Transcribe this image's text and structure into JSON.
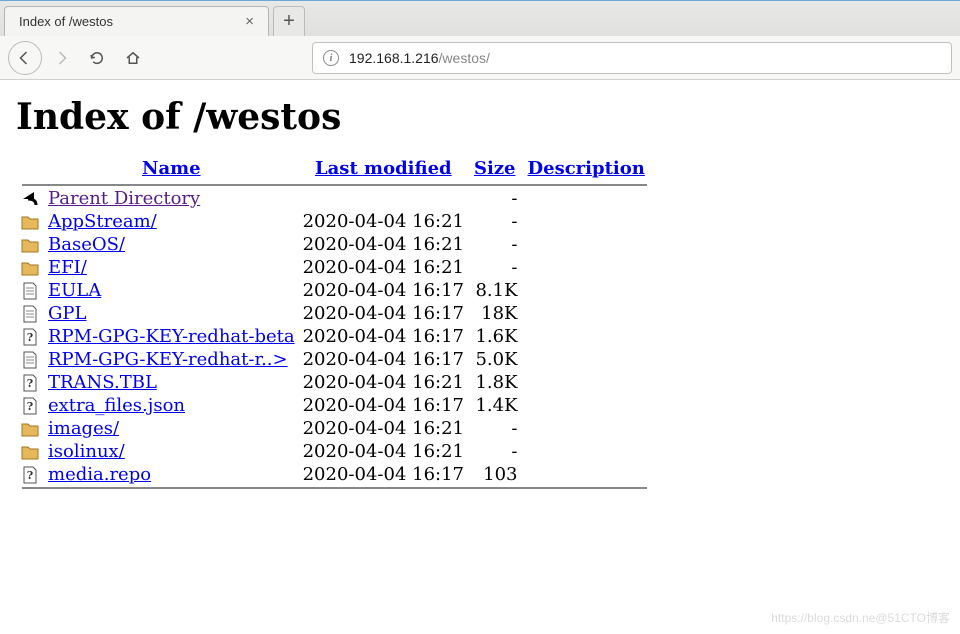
{
  "browser": {
    "tab_title": "Index of /westos",
    "url_host": "192.168.1.216",
    "url_path": "/westos/"
  },
  "page": {
    "heading": "Index of /westos"
  },
  "headers": {
    "name": "Name",
    "last_modified": "Last modified",
    "size": "Size",
    "description": "Description"
  },
  "entries": [
    {
      "icon": "back",
      "name": "Parent Directory",
      "visited": true,
      "modified": "",
      "size": "-"
    },
    {
      "icon": "folder",
      "name": "AppStream/",
      "visited": false,
      "modified": "2020-04-04 16:21",
      "size": "-"
    },
    {
      "icon": "folder",
      "name": "BaseOS/",
      "visited": false,
      "modified": "2020-04-04 16:21",
      "size": "-"
    },
    {
      "icon": "folder",
      "name": "EFI/",
      "visited": false,
      "modified": "2020-04-04 16:21",
      "size": "-"
    },
    {
      "icon": "text",
      "name": "EULA",
      "visited": false,
      "modified": "2020-04-04 16:17",
      "size": "8.1K"
    },
    {
      "icon": "text",
      "name": "GPL",
      "visited": false,
      "modified": "2020-04-04 16:17",
      "size": "18K"
    },
    {
      "icon": "unknown",
      "name": "RPM-GPG-KEY-redhat-beta",
      "visited": false,
      "modified": "2020-04-04 16:17",
      "size": "1.6K"
    },
    {
      "icon": "text",
      "name": "RPM-GPG-KEY-redhat-r..>",
      "visited": false,
      "modified": "2020-04-04 16:17",
      "size": "5.0K"
    },
    {
      "icon": "unknown",
      "name": "TRANS.TBL",
      "visited": false,
      "modified": "2020-04-04 16:21",
      "size": "1.8K"
    },
    {
      "icon": "unknown",
      "name": "extra_files.json",
      "visited": false,
      "modified": "2020-04-04 16:17",
      "size": "1.4K"
    },
    {
      "icon": "folder",
      "name": "images/",
      "visited": false,
      "modified": "2020-04-04 16:21",
      "size": "-"
    },
    {
      "icon": "folder",
      "name": "isolinux/",
      "visited": false,
      "modified": "2020-04-04 16:21",
      "size": "-"
    },
    {
      "icon": "unknown",
      "name": "media.repo",
      "visited": false,
      "modified": "2020-04-04 16:17",
      "size": "103"
    }
  ],
  "watermark": "https://blog.csdn.ne@51CTO博客"
}
